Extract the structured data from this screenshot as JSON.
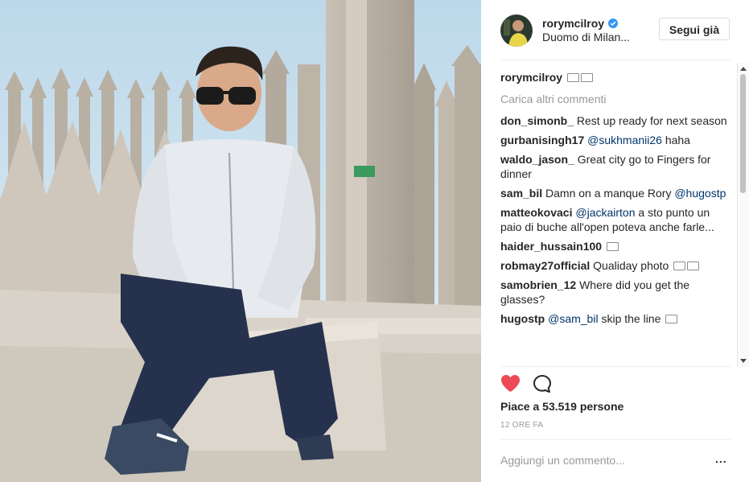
{
  "post": {
    "username": "rorymcilroy",
    "location": "Duomo di Milan...",
    "follow_label": "Segui già",
    "caption_user": "rorymcilroy",
    "load_more": "Carica altri commenti",
    "likes_text": "Piace a 53.519 persone",
    "timestamp": "12 ORE FA",
    "add_comment_placeholder": "Aggiungi un commento...",
    "more_options": "..."
  },
  "comments": [
    {
      "user": "don_simonb_",
      "text": "Rest up ready for next season"
    },
    {
      "user": "gurbanisingh17",
      "mention": "@sukhmanii26",
      "text": "haha"
    },
    {
      "user": "waldo_jason_",
      "text": "Great city go to Fingers for dinner"
    },
    {
      "user": "sam_bil",
      "text": "Damn on a manque Rory",
      "mention": "@hugostp"
    },
    {
      "user": "matteokovaci",
      "mention": "@jackairton",
      "text": "a sto punto un paio di buche all'open poteva anche farle..."
    },
    {
      "user": "haider_hussain100"
    },
    {
      "user": "robmay27official",
      "text": "Qualiday photo"
    },
    {
      "user": "samobrien_12",
      "text": "Where did you get the glasses?"
    },
    {
      "user": "hugostp",
      "mention": "@sam_bil",
      "text": "skip the line"
    }
  ],
  "icons": {
    "verified": "verified-badge-icon",
    "like": "heart-icon",
    "comment": "speech-bubble-icon",
    "emoji": "emoji-icon"
  },
  "colors": {
    "heart": "#ed4956",
    "verified": "#3897f0",
    "muted": "#999999",
    "mention": "#003569"
  }
}
